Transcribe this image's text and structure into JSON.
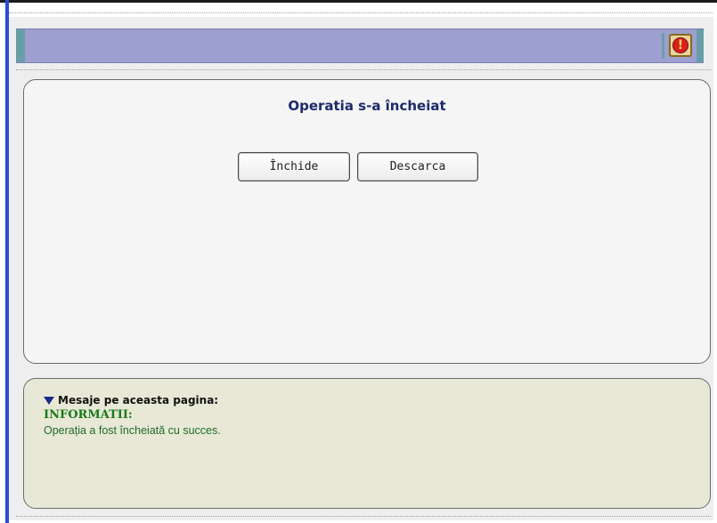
{
  "dialog": {
    "title": "Operatia s-a încheiat",
    "buttons": {
      "close_label": "Închide",
      "download_label": "Descarca"
    }
  },
  "header": {
    "icon": "alert-icon",
    "icon_glyph": "!"
  },
  "messages": {
    "heading": "Mesaje pe aceasta pagina:",
    "type_label": "INFORMATII:",
    "text": "Operația a fost încheiată cu succes."
  },
  "colors": {
    "header_bar": "#9d9fcf",
    "title_text": "#1c2a6a",
    "info_text": "#1a7a1a",
    "message_panel": "#e8e8d6"
  }
}
